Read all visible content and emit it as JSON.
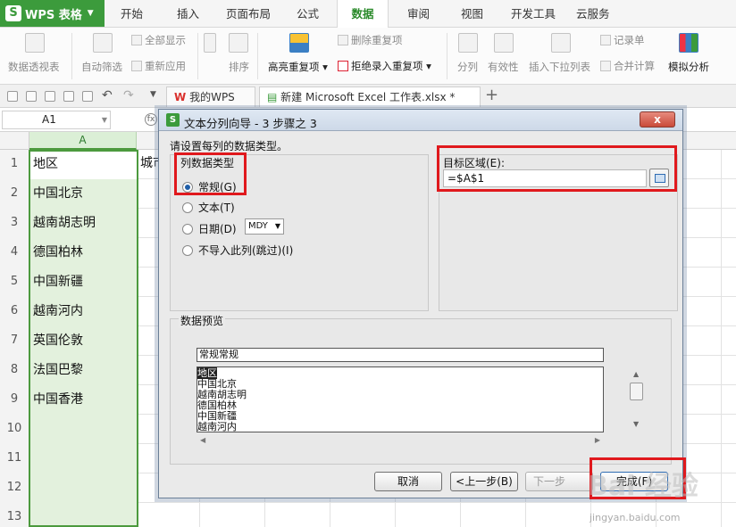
{
  "app": {
    "name": "WPS 表格",
    "logo_letter": "S"
  },
  "menu": {
    "tabs": [
      "开始",
      "插入",
      "页面布局",
      "公式",
      "数据",
      "审阅",
      "视图",
      "开发工具",
      "云服务"
    ],
    "active": "数据"
  },
  "ribbon": {
    "pivot": "数据透视表",
    "autofilter": "自动筛选",
    "show_all": "全部显示",
    "reapply": "重新应用",
    "sort": "排序",
    "highlight_dup": "高亮重复项",
    "remove_dup": "删除重复项",
    "reject_dup": "拒绝录入重复项",
    "split": "分列",
    "validity": "有效性",
    "dropdown": "插入下拉列表",
    "record": "记录单",
    "merge_calc": "合并计算",
    "simulate": "模拟分析"
  },
  "docbar": {
    "home_tab": "我的WPS",
    "file_tab": "新建 Microsoft Excel 工作表.xlsx *",
    "new_tab": "+"
  },
  "formula": {
    "cell_ref": "A1",
    "fx": "fx"
  },
  "sheet": {
    "column": "A",
    "rows": [
      {
        "num": "1",
        "value": "地区"
      },
      {
        "num": "2",
        "value": "中国北京"
      },
      {
        "num": "3",
        "value": "越南胡志明"
      },
      {
        "num": "4",
        "value": "德国柏林"
      },
      {
        "num": "5",
        "value": "中国新疆"
      },
      {
        "num": "6",
        "value": "越南河内"
      },
      {
        "num": "7",
        "value": "英国伦敦"
      },
      {
        "num": "8",
        "value": "法国巴黎"
      },
      {
        "num": "9",
        "value": "中国香港"
      },
      {
        "num": "10",
        "value": ""
      },
      {
        "num": "11",
        "value": ""
      },
      {
        "num": "12",
        "value": ""
      },
      {
        "num": "13",
        "value": ""
      }
    ],
    "b1_partial": "城市"
  },
  "dialog": {
    "title": "文本分列向导 - 3 步骤之 3",
    "close": "x",
    "instruction": "请设置每列的数据类型。",
    "group_type": "列数据类型",
    "opt_general": "常规(G)",
    "opt_text": "文本(T)",
    "opt_date": "日期(D)",
    "date_format": "MDY",
    "opt_skip": "不导入此列(跳过)(I)",
    "target_label": "目标区域(E):",
    "target_value": "=$A$1",
    "preview_title": "数据预览",
    "preview_header": "常规常规",
    "preview_rows": [
      "地区",
      "中国北京",
      "越南胡志明",
      "德国柏林",
      "中国新疆",
      "越南河内"
    ],
    "btn_cancel": "取消",
    "btn_back": "<上一步(B)",
    "btn_next": "下一步",
    "btn_finish": "完成(F)"
  },
  "watermark": {
    "logo": "Bai 经验",
    "url": "jingyan.baidu.com"
  }
}
